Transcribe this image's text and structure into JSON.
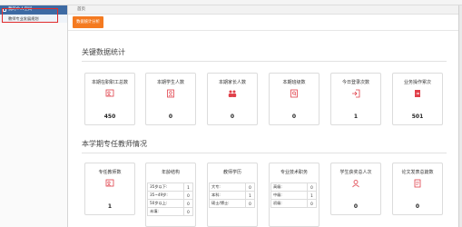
{
  "sidebar": {
    "header": "我的个人空间",
    "items": [
      {
        "label": "教师专业发展规划"
      }
    ]
  },
  "breadcrumb": "首页",
  "tabs": [
    {
      "label": "数据统计分析"
    }
  ],
  "section1": {
    "title": "关键数据统计",
    "cards": [
      {
        "label": "本期在职职工总数",
        "value": "450",
        "icon": "teacher-icon"
      },
      {
        "label": "本期学生人数",
        "value": "0",
        "icon": "student-icon"
      },
      {
        "label": "本期家长人数",
        "value": "0",
        "icon": "parents-icon"
      },
      {
        "label": "本期班级数",
        "value": "0",
        "icon": "class-icon"
      },
      {
        "label": "今日登录次数",
        "value": "1",
        "icon": "login-icon"
      },
      {
        "label": "业务操作累次",
        "value": "501",
        "icon": "operation-icon"
      }
    ]
  },
  "section2": {
    "title": "本学期专任教师情况",
    "cards": [
      {
        "label": "专任教师数",
        "value": "1",
        "icon": "teacher-icon"
      },
      {
        "label": "年龄结构",
        "rows": [
          {
            "k": "35岁以下:",
            "v": "1"
          },
          {
            "k": "35~49岁:",
            "v": "0"
          },
          {
            "k": "50岁以上:",
            "v": "0"
          },
          {
            "k": "未填:",
            "v": "0"
          }
        ]
      },
      {
        "label": "教师学历",
        "rows": [
          {
            "k": "大专:",
            "v": "0"
          },
          {
            "k": "本科:",
            "v": "1"
          },
          {
            "k": "硕士/博士:",
            "v": "0"
          }
        ]
      },
      {
        "label": "专业技术职务",
        "rows": [
          {
            "k": "高级:",
            "v": "0"
          },
          {
            "k": "中级:",
            "v": "1"
          },
          {
            "k": "初级:",
            "v": "0"
          }
        ]
      },
      {
        "label": "学生获奖总人次",
        "value": "0",
        "icon": "award-icon"
      },
      {
        "label": "论文发表总篇数",
        "value": "0",
        "icon": "paper-icon"
      }
    ]
  },
  "colors": {
    "accent": "#f47a20",
    "sidebar_header": "#3d6aa3",
    "highlight": "#e02b2b",
    "icon_red": "#e0404a"
  }
}
